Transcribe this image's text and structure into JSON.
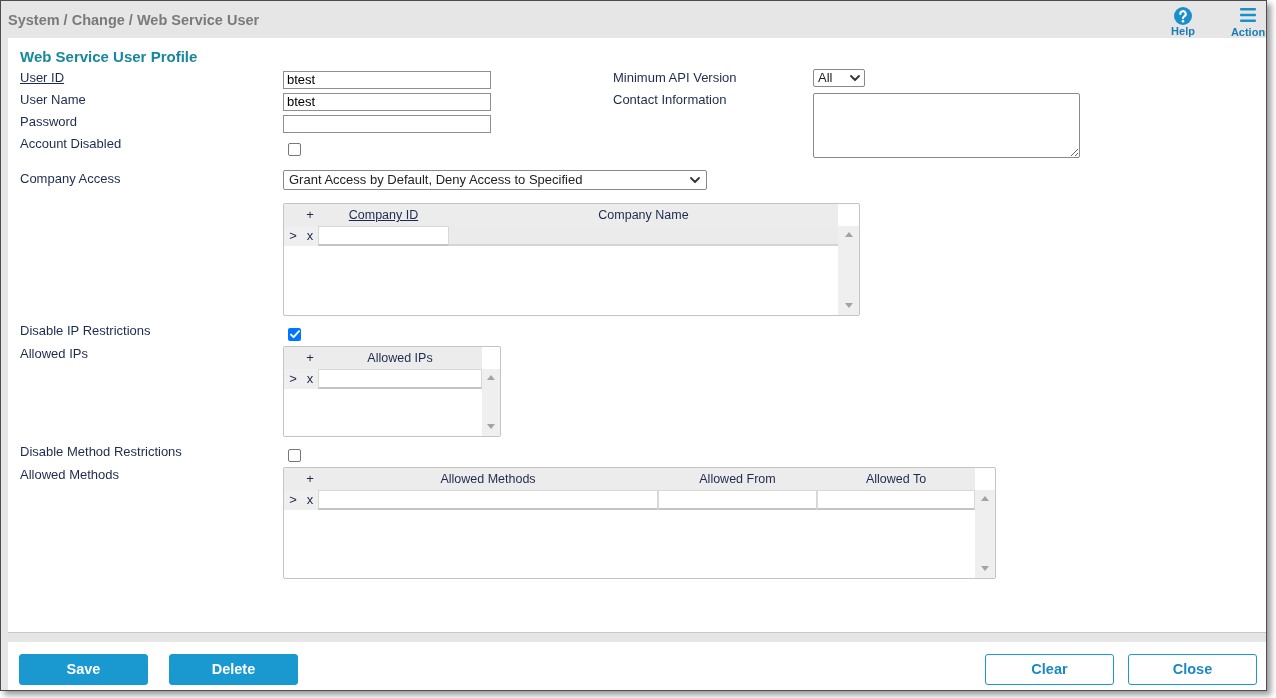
{
  "header": {
    "breadcrumb": "System / Change / Web Service User",
    "actions": [
      {
        "kind": "help",
        "label": "Help"
      },
      {
        "kind": "menu",
        "label": "Action"
      }
    ]
  },
  "profile": {
    "title": "Web Service User Profile",
    "main_fields": [
      {
        "kind": "text",
        "label": "User ID",
        "link": true,
        "value": "btest"
      },
      {
        "kind": "text",
        "label": "User Name",
        "link": false,
        "value": "btest"
      },
      {
        "kind": "password",
        "label": "Password",
        "link": false
      },
      {
        "kind": "checkbox",
        "label": "Account Disabled",
        "link": false,
        "checked": false
      }
    ],
    "side_fields": [
      {
        "kind": "select",
        "label": "Minimum API Version",
        "value": "All"
      },
      {
        "kind": "textarea",
        "label": "Contact Information"
      }
    ],
    "lower_fields": [
      {
        "kind": "select",
        "label": "Company Access",
        "value": "Grant Access by Default, Deny Access to Specified"
      },
      {
        "kind": "grid",
        "add": "+",
        "columns": [
          {
            "label": "Company ID",
            "link": true,
            "readonly": false
          },
          {
            "label": "Company Name",
            "link": false,
            "readonly": true
          }
        ],
        "rows": [
          {
            "marker": ">",
            "remove": "x"
          }
        ]
      },
      {
        "kind": "checkbox",
        "label": "Disable IP Restrictions",
        "checked": true
      },
      {
        "kind": "grid",
        "label": "Allowed IPs",
        "add": "+",
        "columns": [
          {
            "label": "Allowed IPs",
            "link": false,
            "readonly": false
          }
        ],
        "rows": [
          {
            "marker": ">",
            "remove": "x"
          }
        ]
      },
      {
        "kind": "checkbox",
        "label": "Disable Method Restrictions",
        "checked": false
      },
      {
        "kind": "grid",
        "label": "Allowed Methods",
        "add": "+",
        "columns": [
          {
            "label": "Allowed Methods",
            "link": false,
            "readonly": false
          },
          {
            "label": "Allowed From",
            "link": false,
            "readonly": false
          },
          {
            "label": "Allowed To",
            "link": false,
            "readonly": false
          }
        ],
        "rows": [
          {
            "marker": ">",
            "remove": "x"
          }
        ]
      }
    ]
  },
  "footer": {
    "buttons": [
      {
        "kind": "primary",
        "label": "Save"
      },
      {
        "kind": "primary",
        "label": "Delete"
      },
      {
        "kind": "secondary",
        "label": "Clear"
      },
      {
        "kind": "secondary",
        "label": "Close"
      }
    ]
  }
}
